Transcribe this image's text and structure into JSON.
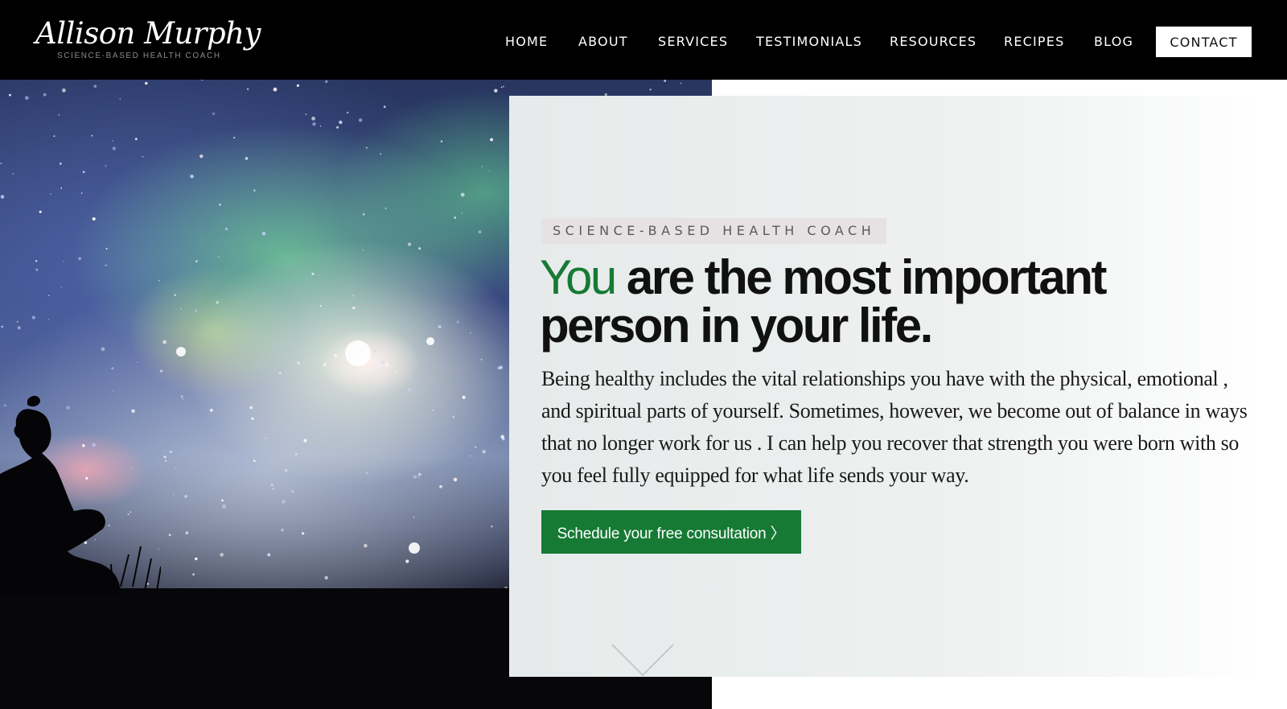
{
  "brand": {
    "name": "Allison Murphy",
    "tagline": "SCIENCE-BASED HEALTH COACH"
  },
  "nav": {
    "items": [
      "HOME",
      "ABOUT",
      "SERVICES",
      "TESTIMONIALS",
      "RESOURCES",
      "RECIPES",
      "BLOG"
    ],
    "contact": "CONTACT"
  },
  "hero": {
    "eyebrow": "SCIENCE-BASED HEALTH COACH",
    "headline_accent": "You",
    "headline_rest": " are the most important person in your life.",
    "body": "Being healthy includes the vital relationships you have with the physical, emotional , and spiritual parts of yourself. Sometimes, however, we become out of balance in ways that no longer work for us . I can help you recover that strength you were born with so you feel fully equipped for what life sends your way.",
    "cta": "Schedule your free consultation 〉",
    "scroll_icon": "chevron-down-icon"
  },
  "colors": {
    "header_bg": "#000000",
    "accent_green": "#167a34",
    "panel_bg": "#e6eaea",
    "text_dark": "#111111"
  }
}
